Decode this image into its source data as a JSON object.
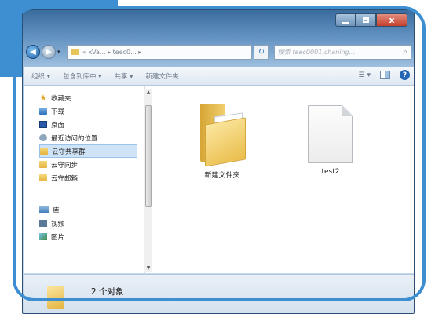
{
  "window": {
    "caption": {
      "minimize": "",
      "maximize": "",
      "close": "x"
    }
  },
  "address": {
    "back_glyph": "◀",
    "forward_glyph": "▶",
    "path": "« xVa... ▸ teec0... ▸",
    "refresh_glyph": "↻",
    "search_placeholder": "搜索 teec0001.chaning...",
    "search_glyph": "⌕"
  },
  "toolbar": {
    "organize": "组织 ▾",
    "include_in_library": "包含到库中 ▾",
    "share": "共享 ▾",
    "new_folder": "新建文件夹",
    "views": "☰ ▾",
    "help": "?"
  },
  "nav": {
    "items": [
      {
        "label": "收藏夹",
        "icon": "star-icon"
      },
      {
        "label": "下载",
        "icon": "download-icon"
      },
      {
        "label": "桌面",
        "icon": "desktop-icon"
      },
      {
        "label": "最近访问的位置",
        "icon": "recent-places-icon"
      },
      {
        "label": "云守共享群",
        "icon": "folder-icon",
        "selected": true
      },
      {
        "label": "云守同步",
        "icon": "folder-icon"
      },
      {
        "label": "云守邮箱",
        "icon": "folder-icon"
      },
      {
        "label": "库",
        "icon": "library-icon"
      },
      {
        "label": "视频",
        "icon": "video-icon"
      },
      {
        "label": "图片",
        "icon": "pictures-icon"
      }
    ]
  },
  "files": [
    {
      "name": "新建文件夹",
      "type": "folder"
    },
    {
      "name": "test2",
      "type": "file"
    }
  ],
  "status": {
    "count": "2 个对象"
  },
  "colors": {
    "accent": "#3d8fd2",
    "selection": "#cfe3f7"
  }
}
